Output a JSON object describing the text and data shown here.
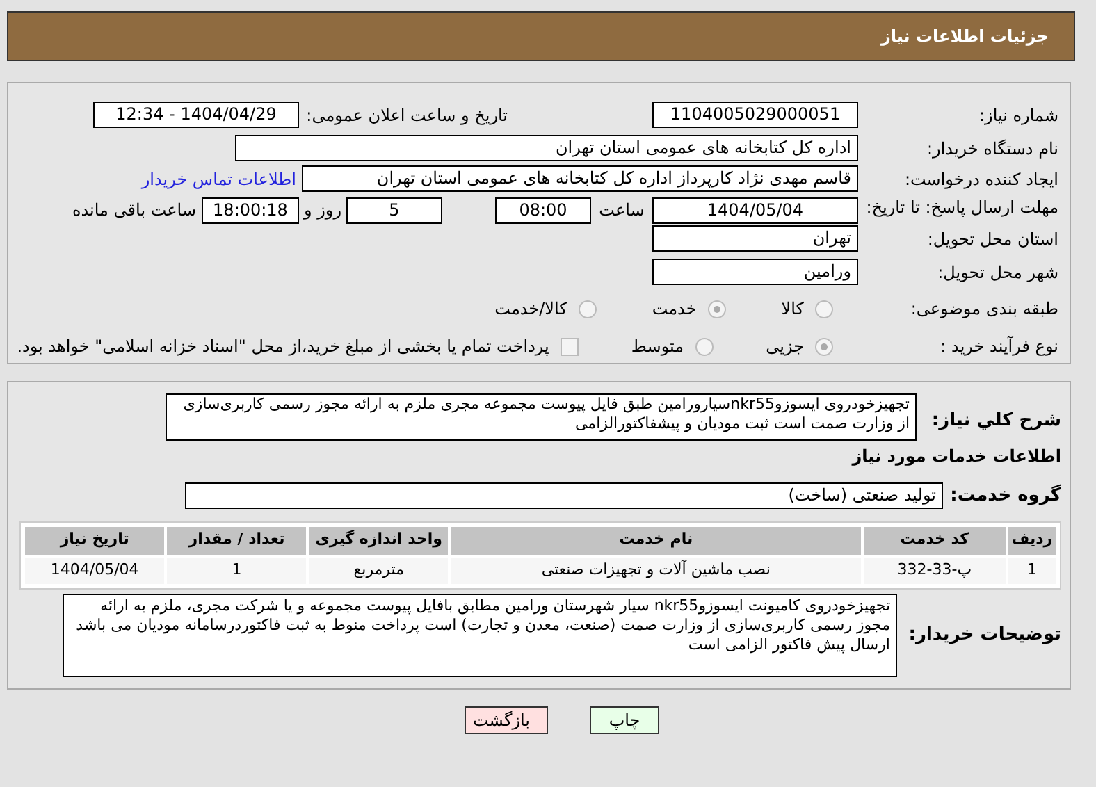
{
  "title": "جزئیات اطلاعات نیاز",
  "need_number": {
    "label": "شماره نیاز:",
    "value": "1104005029000051"
  },
  "announce": {
    "label": "تاریخ و ساعت اعلان عمومی:",
    "value": "1404/04/29 - 12:34"
  },
  "buyer_org": {
    "label": "نام دستگاه خریدار:",
    "value": "اداره کل کتابخانه های عمومی استان تهران"
  },
  "requester": {
    "label": "ایجاد کننده درخواست:",
    "value": "قاسم مهدی نژاد کارپرداز اداره کل کتابخانه های عمومی استان تهران",
    "link": "اطلاعات تماس خریدار"
  },
  "deadline": {
    "label": "مهلت ارسال پاسخ: تا تاریخ:",
    "date": "1404/05/04",
    "time_label": "ساعت",
    "time": "08:00",
    "days": "5",
    "days_label": "روز و",
    "remaining": "18:00:18",
    "remaining_label": "ساعت باقی مانده"
  },
  "province": {
    "label": "استان محل تحویل:",
    "value": "تهران"
  },
  "city": {
    "label": "شهر محل تحویل:",
    "value": "ورامین"
  },
  "category": {
    "label": "طبقه بندی موضوعی:",
    "options": [
      {
        "label": "کالا",
        "selected": false
      },
      {
        "label": "خدمت",
        "selected": true
      },
      {
        "label": "کالا/خدمت",
        "selected": false
      }
    ]
  },
  "process": {
    "label": "نوع فرآیند خرید :",
    "options": [
      {
        "label": "جزیی",
        "selected": true
      },
      {
        "label": "متوسط",
        "selected": false
      }
    ],
    "payment": {
      "label": "پرداخت تمام یا بخشی از مبلغ خرید،از محل \"اسناد خزانه اسلامی\" خواهد بود.",
      "checked": false
    }
  },
  "description": {
    "label": "شرح کلي نياز:",
    "value": "تجهیزخودروی ایسوزوnkr55سیارورامین طبق فایل پیوست مجموعه مجری ملزم به ارائه مجوز رسمی کاربری‌سازی از وزارت صمت است ثبت مودیان و پیشفاکتورالزامی"
  },
  "services_heading": "اطلاعات خدمات مورد نياز",
  "service_group": {
    "label": "گروه خدمت:",
    "value": "تولید صنعتی (ساخت)"
  },
  "table": {
    "columns": [
      "ردیف",
      "کد خدمت",
      "نام خدمت",
      "واحد اندازه گیری",
      "تعداد / مقدار",
      "تاریخ نیاز"
    ],
    "rows": [
      [
        "1",
        "پ-33-332",
        "نصب ماشین آلات و تجهیزات صنعتی",
        "مترمربع",
        "1",
        "1404/05/04"
      ]
    ]
  },
  "buyer_notes": {
    "label": "توضیحات خریدار:",
    "value": "تجهیزخودروی کامیونت ایسوزوnkr55 سیار شهرستان ورامین مطابق بافایل پیوست مجموعه و یا شرکت مجری، ملزم به ارائه مجوز رسمی کاربری‌سازی از وزارت صمت (صنعت، معدن و تجارت) است پرداخت منوط به ثبت فاکتوردرسامانه مودیان می باشد ارسال پیش فاکتور الزامی است"
  },
  "buttons": [
    {
      "label": "چاپ",
      "kind": "print"
    },
    {
      "label": "بازگشت",
      "kind": "back"
    }
  ]
}
